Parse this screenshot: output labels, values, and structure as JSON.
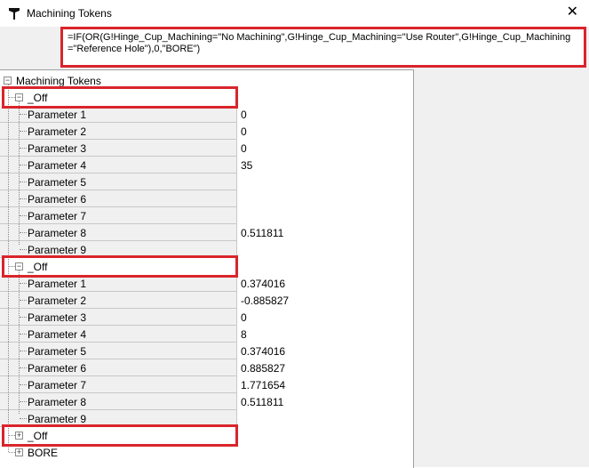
{
  "window": {
    "title": "Machining Tokens",
    "close_glyph": "✕",
    "icon": "tool-icon"
  },
  "formula": "=IF(OR(G!Hinge_Cup_Machining=\"No Machining\",G!Hinge_Cup_Machining=\"Use Router\",G!Hinge_Cup_Machining=\"Reference Hole\"),0,\"BORE\")",
  "tree": {
    "root": "Machining Tokens",
    "groups": [
      {
        "name": "_Off",
        "expanded": true,
        "params": [
          {
            "name": "Parameter 1",
            "value": "0"
          },
          {
            "name": "Parameter 2",
            "value": "0"
          },
          {
            "name": "Parameter 3",
            "value": "0"
          },
          {
            "name": "Parameter 4",
            "value": "35"
          },
          {
            "name": "Parameter 5",
            "value": ""
          },
          {
            "name": "Parameter 6",
            "value": ""
          },
          {
            "name": "Parameter 7",
            "value": ""
          },
          {
            "name": "Parameter 8",
            "value": "0.511811"
          },
          {
            "name": "Parameter 9",
            "value": ""
          }
        ]
      },
      {
        "name": "_Off",
        "expanded": true,
        "params": [
          {
            "name": "Parameter 1",
            "value": "0.374016"
          },
          {
            "name": "Parameter 2",
            "value": "-0.885827"
          },
          {
            "name": "Parameter 3",
            "value": "0"
          },
          {
            "name": "Parameter 4",
            "value": "8"
          },
          {
            "name": "Parameter 5",
            "value": "0.374016"
          },
          {
            "name": "Parameter 6",
            "value": "0.885827"
          },
          {
            "name": "Parameter 7",
            "value": "1.771654"
          },
          {
            "name": "Parameter 8",
            "value": "0.511811"
          },
          {
            "name": "Parameter 9",
            "value": ""
          }
        ]
      },
      {
        "name": "_Off",
        "expanded": false,
        "params": []
      },
      {
        "name": "BORE",
        "expanded": false,
        "params": []
      }
    ]
  },
  "colors": {
    "highlight": "#d9252b",
    "name_column_bg": "#f0f0f0"
  }
}
